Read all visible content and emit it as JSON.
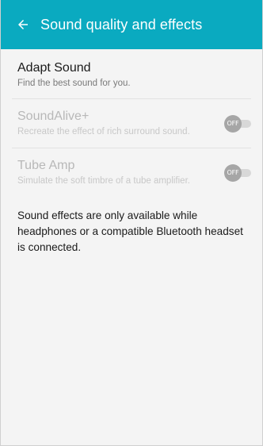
{
  "app_bar": {
    "title": "Sound quality and effects",
    "back_icon": "arrow-left-icon",
    "color": "#0aaac0"
  },
  "settings": [
    {
      "name": "Adapt Sound",
      "description": "Find the best sound for you.",
      "enabled": true
    },
    {
      "name": "SoundAlive+",
      "description": "Recreate the effect of rich surround sound.",
      "enabled": false,
      "toggle_label": "OFF"
    },
    {
      "name": "Tube Amp",
      "description": "Simulate the soft timbre of a tube amplifier.",
      "enabled": false,
      "toggle_label": "OFF"
    }
  ],
  "note": "Sound effects are only available while headphones or a compatible Bluetooth headset is connected."
}
